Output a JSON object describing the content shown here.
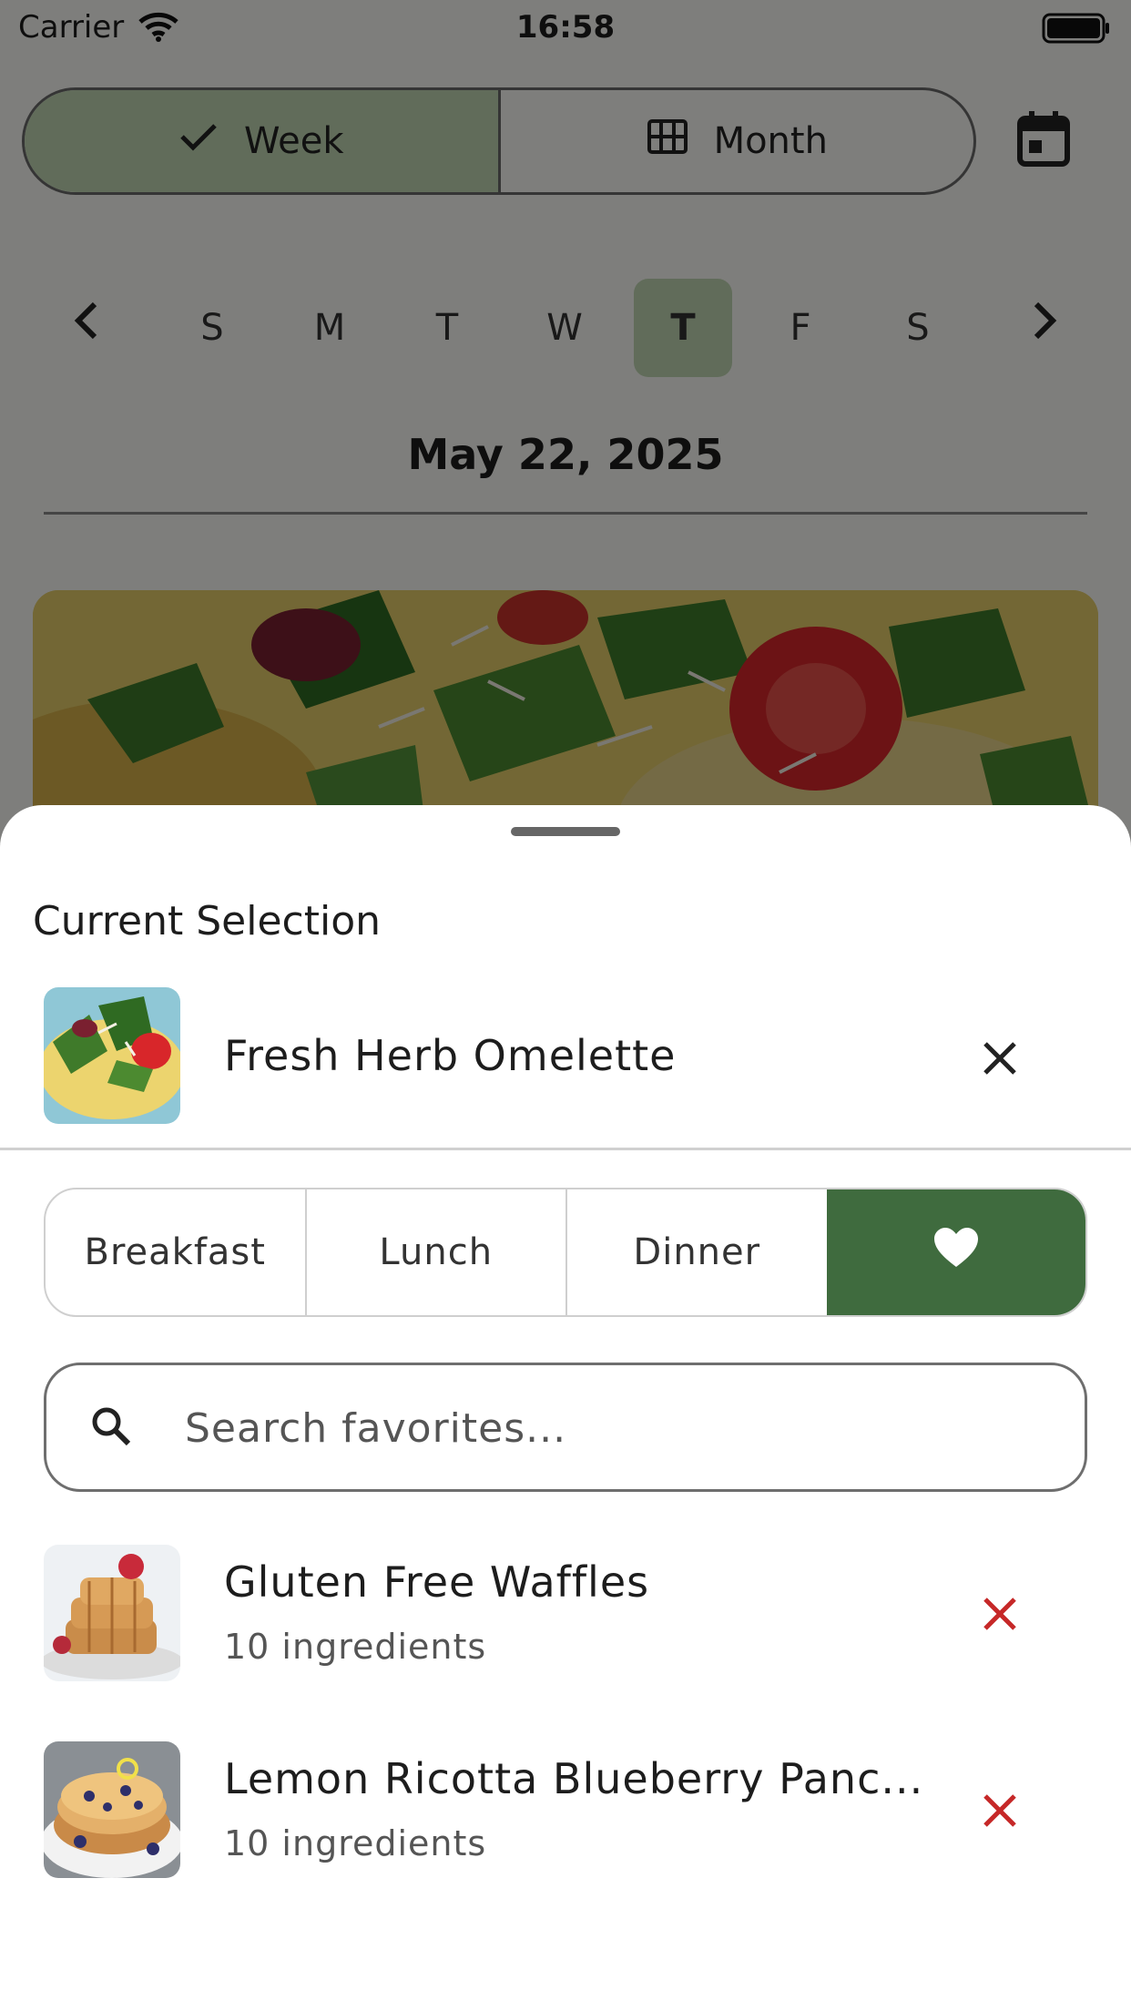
{
  "status_bar": {
    "carrier": "Carrier",
    "time": "16:58"
  },
  "view_toggle": {
    "week_label": "Week",
    "month_label": "Month",
    "selected": "Week"
  },
  "week": {
    "days": [
      "S",
      "M",
      "T",
      "W",
      "T",
      "F",
      "S"
    ],
    "selected_index": 4
  },
  "selected_date": "May 22, 2025",
  "sheet": {
    "heading": "Current Selection",
    "current": {
      "name": "Fresh Herb Omelette"
    },
    "meal_tabs": {
      "breakfast": "Breakfast",
      "lunch": "Lunch",
      "dinner": "Dinner",
      "active": "favorites"
    },
    "search": {
      "placeholder": "Search favorites..."
    },
    "favorites": [
      {
        "title": "Gluten Free Waffles",
        "subtitle": "10 ingredients"
      },
      {
        "title": "Lemon Ricotta Blueberry Panc...",
        "subtitle": "10 ingredients"
      }
    ]
  },
  "colors": {
    "accent_green": "#3f6b3e",
    "selected_green": "#c2d9b5",
    "remove_red": "#c62828"
  }
}
